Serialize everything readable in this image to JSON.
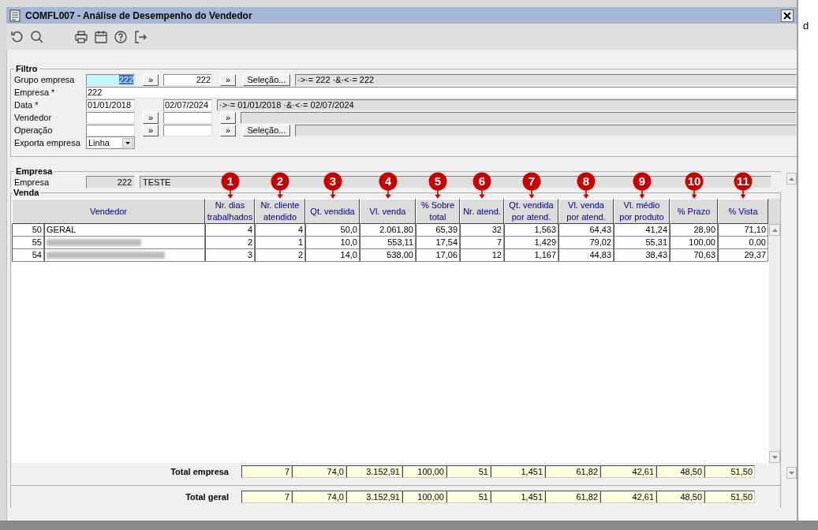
{
  "window": {
    "title": "COMFL007 - Análise de Desempenho do Vendedor"
  },
  "filter": {
    "title": "Filtro",
    "rows": [
      {
        "kind": "range",
        "label": "Grupo empresa",
        "from": "222",
        "focused": true,
        "from_button": "»",
        "to": "222",
        "to_button": "»",
        "selection_button": "Seleção...",
        "summary": "·>·= 222 ·&·<·= 222"
      },
      {
        "kind": "text",
        "label": "Empresa *",
        "value": "222"
      },
      {
        "kind": "range",
        "label": "Data *",
        "from": "01/01/2018",
        "focused": false,
        "to": "02/07/2024",
        "summary": "·>·= 01/01/2018 ·&·<·= 02/07/2024"
      },
      {
        "kind": "range",
        "label": "Vendedor",
        "focused": false,
        "from_button": "»",
        "to_button": "»"
      },
      {
        "kind": "range",
        "label": "Operação",
        "focused": false,
        "from_button": "»",
        "to_button": "»",
        "selection_button": "Seleção..."
      },
      {
        "kind": "select",
        "label": "Exporta empresa",
        "value": "Linha"
      }
    ]
  },
  "empresa": {
    "title": "Empresa",
    "label": "Empresa",
    "code": "222",
    "name": "TESTE"
  },
  "venda": {
    "title": "Venda",
    "columns": [
      {
        "label": "Vendedor"
      },
      {
        "label": "Nr. dias\ntrabalhados",
        "marker": "1"
      },
      {
        "label": "Nr. cliente\natendido",
        "marker": "2"
      },
      {
        "label": "Qt. vendida",
        "marker": "3"
      },
      {
        "label": "Vl. venda",
        "marker": "4"
      },
      {
        "label": "% Sobre\ntotal",
        "marker": "5"
      },
      {
        "label": "Nr. atend.",
        "marker": "6"
      },
      {
        "label": "Qt. vendida\npor atend.",
        "marker": "7"
      },
      {
        "label": "Vl. venda\npor  atend.",
        "marker": "8"
      },
      {
        "label": "Vl.  médio\npor  produto",
        "marker": "9"
      },
      {
        "label": "% Prazo",
        "marker": "10"
      },
      {
        "label": "% Vista",
        "marker": "11"
      }
    ],
    "rows": [
      {
        "code": "50",
        "name": "GERAL",
        "redacted": false,
        "values": [
          "4",
          "4",
          "50,0",
          "2.061,80",
          "65,39",
          "32",
          "1,563",
          "64,43",
          "41,24",
          "28,90",
          "71,10"
        ]
      },
      {
        "code": "55",
        "redacted": true,
        "values": [
          "2",
          "1",
          "10,0",
          "553,11",
          "17,54",
          "7",
          "1,429",
          "79,02",
          "55,31",
          "100,00",
          "0,00"
        ]
      },
      {
        "code": "54",
        "redacted": true,
        "values": [
          "3",
          "2",
          "14,0",
          "538,00",
          "17,06",
          "12",
          "1,167",
          "44,83",
          "38,43",
          "70,63",
          "29,37"
        ]
      }
    ],
    "totals": [
      {
        "label": "Total empresa",
        "values": [
          "7",
          "74,0",
          "3.152,91",
          "100,00",
          "51",
          "1,451",
          "61,82",
          "42,61",
          "48,50",
          "51,50"
        ]
      },
      {
        "label": "Total geral",
        "values": [
          "7",
          "74,0",
          "3.152,91",
          "100,00",
          "51",
          "1,451",
          "61,82",
          "42,61",
          "48,50",
          "51,50"
        ]
      }
    ]
  },
  "background_window": {
    "text": "d"
  }
}
